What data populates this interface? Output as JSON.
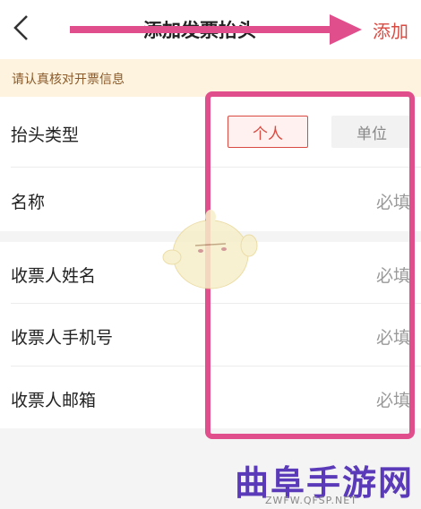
{
  "header": {
    "title": "添加发票抬头",
    "add_label": "添加"
  },
  "notice": "请认真核对开票信息",
  "form": {
    "title_type_label": "抬头类型",
    "options": [
      {
        "label": "个人",
        "selected": true
      },
      {
        "label": "单位",
        "selected": false
      }
    ],
    "name_label": "名称",
    "name_placeholder": "必填",
    "recipient_name_label": "收票人姓名",
    "recipient_name_placeholder": "必填",
    "recipient_phone_label": "收票人手机号",
    "recipient_phone_placeholder": "必填",
    "recipient_email_label": "收票人邮箱",
    "recipient_email_placeholder": "必填"
  },
  "watermark": {
    "text": "曲阜手游网",
    "url": "ZWFW.QFSP.NET"
  },
  "colors": {
    "accent": "#d94b42",
    "annotation": "#e04e8c",
    "notice_bg": "#fdf3df"
  }
}
